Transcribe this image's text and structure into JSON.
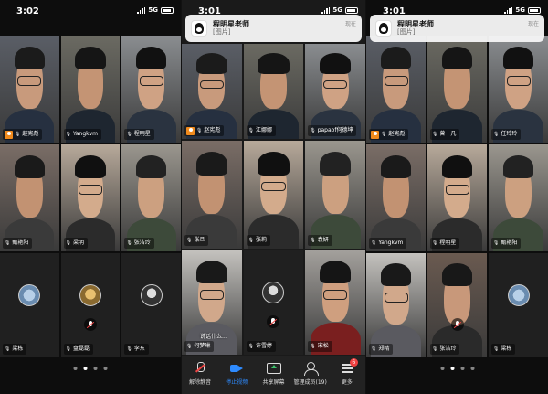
{
  "screen1": {
    "time": "3:02",
    "network": "5G",
    "tiles": [
      {
        "name": "赵宪彪",
        "host": true,
        "active": true
      },
      {
        "name": "Yangkvm"
      },
      {
        "name": "程明星"
      },
      {
        "name": "甄艳阳"
      },
      {
        "name": "梁明"
      },
      {
        "name": "张洁玲"
      },
      {
        "name": "梁栋",
        "avatar": "blue"
      },
      {
        "name": "盘磊磊",
        "avatar": "cat",
        "muted": true
      },
      {
        "name": "李东",
        "avatar": "bw"
      }
    ],
    "pages": 4,
    "current_page": 2
  },
  "screen2": {
    "time": "3:01",
    "network": "5G",
    "notification": {
      "sender": "程明星老师",
      "message": "[图片]",
      "when": "现在"
    },
    "tiles": [
      {
        "name": "赵宪彪",
        "host": true
      },
      {
        "name": "江娜娜"
      },
      {
        "name": "papaof何德坤"
      },
      {
        "name": "张旦"
      },
      {
        "name": "张莉",
        "active": true
      },
      {
        "name": "袁妍"
      },
      {
        "name": "何梦琳",
        "overlay": "说话什么..."
      },
      {
        "name": "许雪婷",
        "avatar": "bw",
        "muted": true
      },
      {
        "name": "宋松"
      }
    ],
    "toolbar": [
      {
        "label": "解除静音",
        "icon": "mic-muted-icon"
      },
      {
        "label": "停止视频",
        "icon": "video-icon",
        "on": true
      },
      {
        "label": "共享屏幕",
        "icon": "share-screen-icon"
      },
      {
        "label": "管理成员(19)",
        "icon": "members-icon"
      },
      {
        "label": "更多",
        "icon": "more-icon",
        "badge": "6"
      }
    ]
  },
  "screen3": {
    "time": "3:01",
    "network": "5G",
    "notification": {
      "sender": "程明星老师",
      "message": "[图片]",
      "when": "现在"
    },
    "tiles": [
      {
        "name": "赵宪彪",
        "host": true,
        "active": true
      },
      {
        "name": "曾一凡"
      },
      {
        "name": "任玲玲"
      },
      {
        "name": "Yangkvm"
      },
      {
        "name": "程明星"
      },
      {
        "name": "甄艳阳"
      },
      {
        "name": "郑晴"
      },
      {
        "name": "张洁玲",
        "muted": true
      },
      {
        "name": "梁栋",
        "avatar": "blue"
      }
    ],
    "pages": 4,
    "current_page": 2
  },
  "colors": {
    "active_border": "#3cc36b",
    "host_badge": "#f08a1c",
    "toolbar_accent": "#2e8bff",
    "badge": "#f04040"
  }
}
